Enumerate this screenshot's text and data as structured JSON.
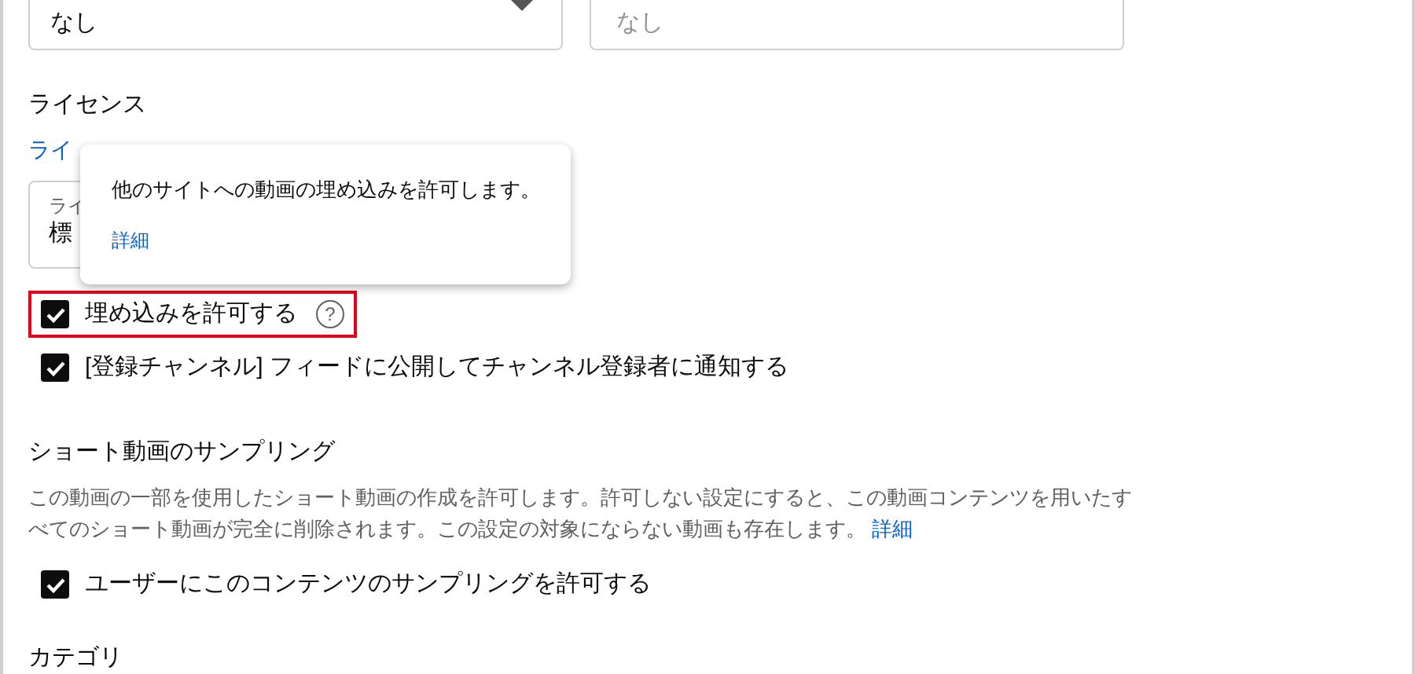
{
  "top_fields": [
    {
      "kind": "select",
      "value": "なし"
    },
    {
      "kind": "text",
      "placeholder": "なし"
    }
  ],
  "license": {
    "heading": "ライセンス",
    "link": "ライ",
    "field_label": "ライ",
    "field_value": "標"
  },
  "tooltip": {
    "text": "他のサイトへの動画の埋め込みを許可します。",
    "link": "詳細"
  },
  "options": [
    {
      "label": "埋め込みを許可する",
      "checked": true,
      "highlighted": true,
      "help_icon": "?"
    },
    {
      "label": "[登録チャンネル] フィードに公開してチャンネル登録者に通知する",
      "checked": true,
      "highlighted": false
    }
  ],
  "shorts": {
    "heading": "ショート動画のサンプリング",
    "description": "この動画の一部を使用したショート動画の作成を許可します。許可しない設定にすると、この動画コンテンツを用いたすべてのショート動画が完全に削除されます。この設定の対象にならない動画も存在します。",
    "link": "詳細",
    "options": [
      {
        "label": "ユーザーにこのコンテンツのサンプリングを許可する",
        "checked": true
      }
    ]
  },
  "next_heading": "カテゴリ"
}
